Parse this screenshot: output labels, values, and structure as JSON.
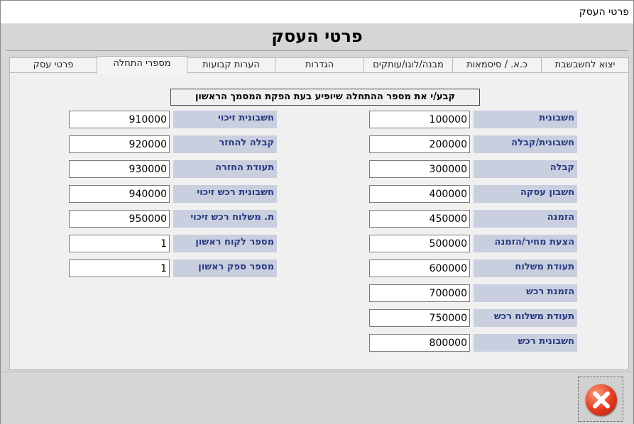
{
  "window": {
    "title": "פרטי העסק"
  },
  "header": {
    "title": "פרטי העסק"
  },
  "tabs": [
    {
      "label": "יצוא לחשבשבת"
    },
    {
      "label": "כ.א. / סיסמאות"
    },
    {
      "label": "מבנה/לוגו/עותקים"
    },
    {
      "label": "הגדרות"
    },
    {
      "label": "הערות קבועות"
    },
    {
      "label": "מספרי התחלה",
      "active": true
    },
    {
      "label": "פרטי עסק"
    }
  ],
  "panel": {
    "instruction": "קבע/י את מספר ההתחלה שיופיע בעת הפקת המסמך הראשון",
    "right_fields": [
      {
        "label": "חשבונית",
        "value": "100000"
      },
      {
        "label": "חשבונית/קבלה",
        "value": "200000"
      },
      {
        "label": "קבלה",
        "value": "300000"
      },
      {
        "label": "חשבון עסקה",
        "value": "400000"
      },
      {
        "label": "הזמנה",
        "value": "450000"
      },
      {
        "label": "הצעת מחיר/הזמנה",
        "value": "500000"
      },
      {
        "label": "תעודת משלוח",
        "value": "600000"
      },
      {
        "label": "הזמנת רכש",
        "value": "700000"
      },
      {
        "label": "תעודת משלוח רכש",
        "value": "750000"
      },
      {
        "label": "חשבונית רכש",
        "value": "800000"
      }
    ],
    "left_fields": [
      {
        "label": "חשבונית זיכוי",
        "value": "910000"
      },
      {
        "label": "קבלה להחזר",
        "value": "920000"
      },
      {
        "label": "תעודת החזרה",
        "value": "930000"
      },
      {
        "label": "חשבונית רכש זיכוי",
        "value": "940000"
      },
      {
        "label": "ת. משלוח רכש זיכוי",
        "value": "950000"
      },
      {
        "label": "מספר לקוח ראשון",
        "value": "1"
      },
      {
        "label": "מספר ספק ראשון",
        "value": "1"
      }
    ]
  },
  "footer": {
    "close_icon": "close-icon",
    "close_color": "#e23a1f"
  }
}
